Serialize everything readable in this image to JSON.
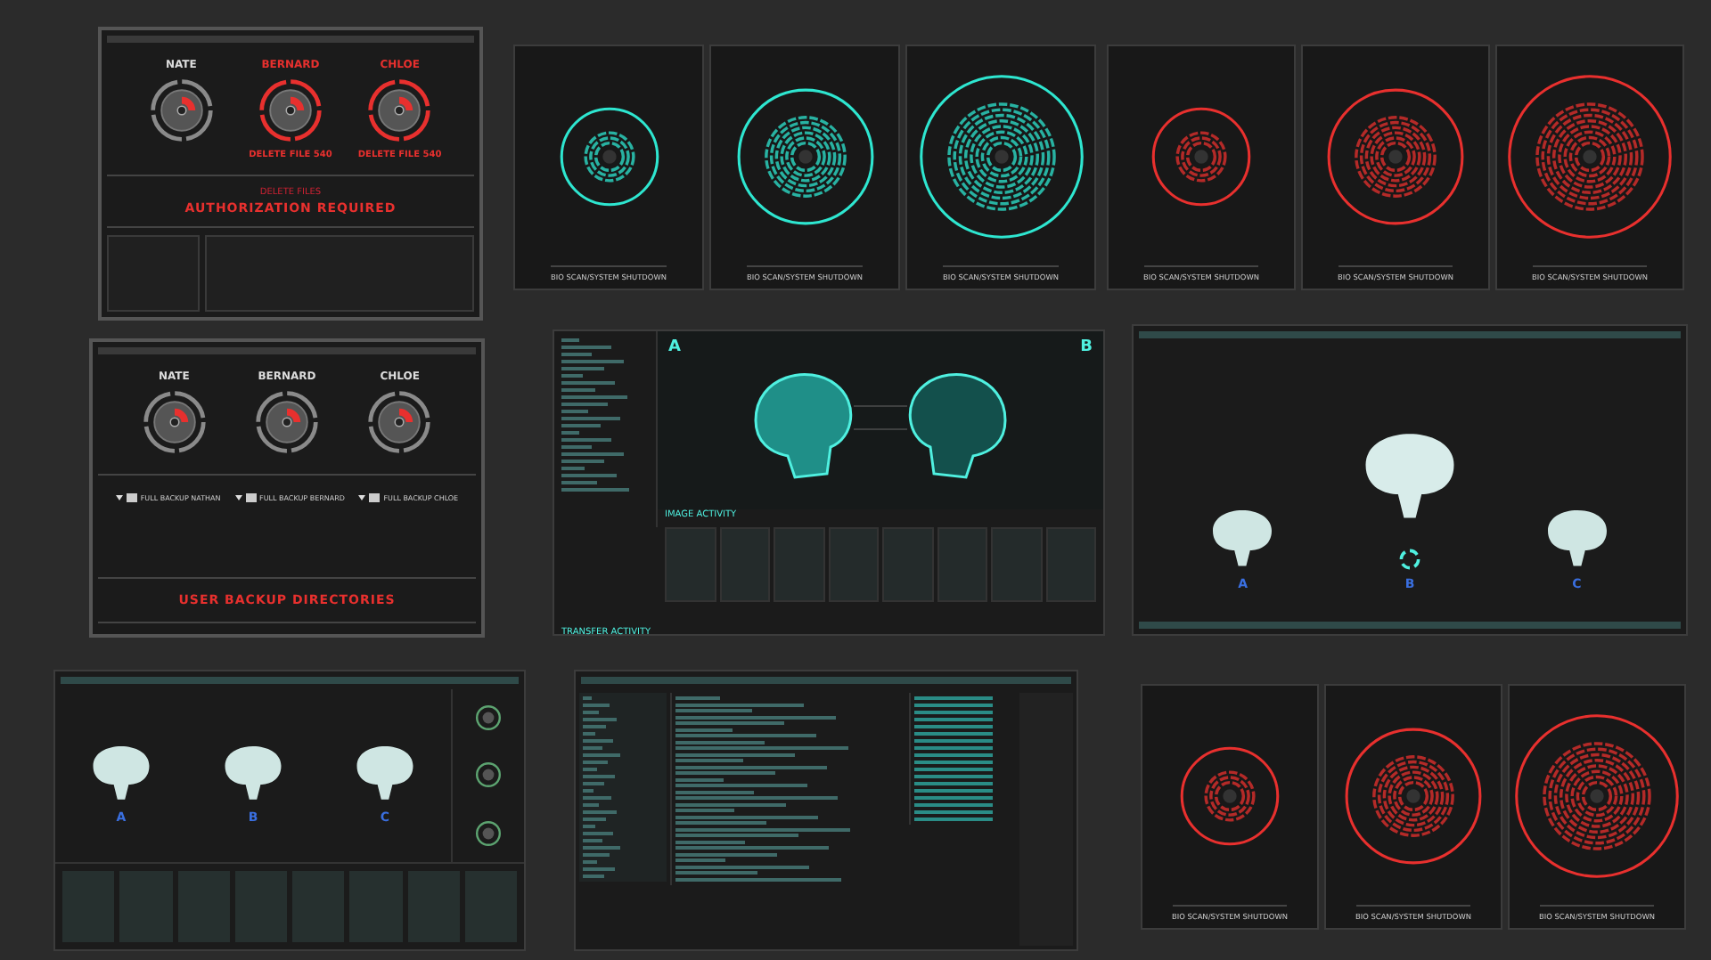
{
  "auth_panel": {
    "users": [
      {
        "name": "NATE",
        "alert": false
      },
      {
        "name": "BERNARD",
        "alert": true,
        "action": "DELETE FILE 540"
      },
      {
        "name": "CHLOE",
        "alert": true,
        "action": "DELETE FILE 540"
      }
    ],
    "subtitle": "DELETE FILES",
    "title": "AUTHORIZATION REQUIRED"
  },
  "scan_sequences": [
    {
      "color": "#2ee6d0",
      "frames": [
        {
          "kind": "small",
          "caption": "BIO SCAN/SYSTEM SHUTDOWN"
        },
        {
          "kind": "medium",
          "caption": "BIO SCAN/SYSTEM SHUTDOWN"
        },
        {
          "kind": "large",
          "caption": "BIO SCAN/SYSTEM SHUTDOWN"
        }
      ]
    },
    {
      "color": "#e8302e",
      "frames": [
        {
          "kind": "small",
          "caption": "BIO SCAN/SYSTEM SHUTDOWN"
        },
        {
          "kind": "medium",
          "caption": "BIO SCAN/SYSTEM SHUTDOWN"
        },
        {
          "kind": "large",
          "caption": "BIO SCAN/SYSTEM SHUTDOWN"
        }
      ]
    }
  ],
  "backup_panel": {
    "users": [
      {
        "name": "NATE"
      },
      {
        "name": "BERNARD"
      },
      {
        "name": "CHLOE"
      }
    ],
    "directories": [
      {
        "label": "FULL BACKUP NATHAN",
        "expanded": true
      },
      {
        "label": "FULL BACKUP BERNARD",
        "expanded": true
      },
      {
        "label": "FULL BACKUP CHLOE",
        "expanded": true
      }
    ],
    "title": "USER BACKUP DIRECTORIES"
  },
  "skull_viewer": {
    "labels": [
      "A",
      "B"
    ],
    "section_title": "IMAGE ACTIVITY",
    "footer_title": "TRANSFER ACTIVITY"
  },
  "brain_compare": {
    "labels": [
      "A",
      "B",
      "C"
    ]
  },
  "brain_dashboard": {
    "labels": [
      "A",
      "B",
      "C"
    ]
  },
  "bottom_scan_sequence": {
    "color": "#e8302e",
    "frames": [
      {
        "kind": "small",
        "caption": "BIO SCAN/SYSTEM SHUTDOWN"
      },
      {
        "kind": "medium",
        "caption": "BIO SCAN/SYSTEM SHUTDOWN"
      },
      {
        "kind": "large",
        "caption": "BIO SCAN/SYSTEM SHUTDOWN"
      }
    ]
  }
}
